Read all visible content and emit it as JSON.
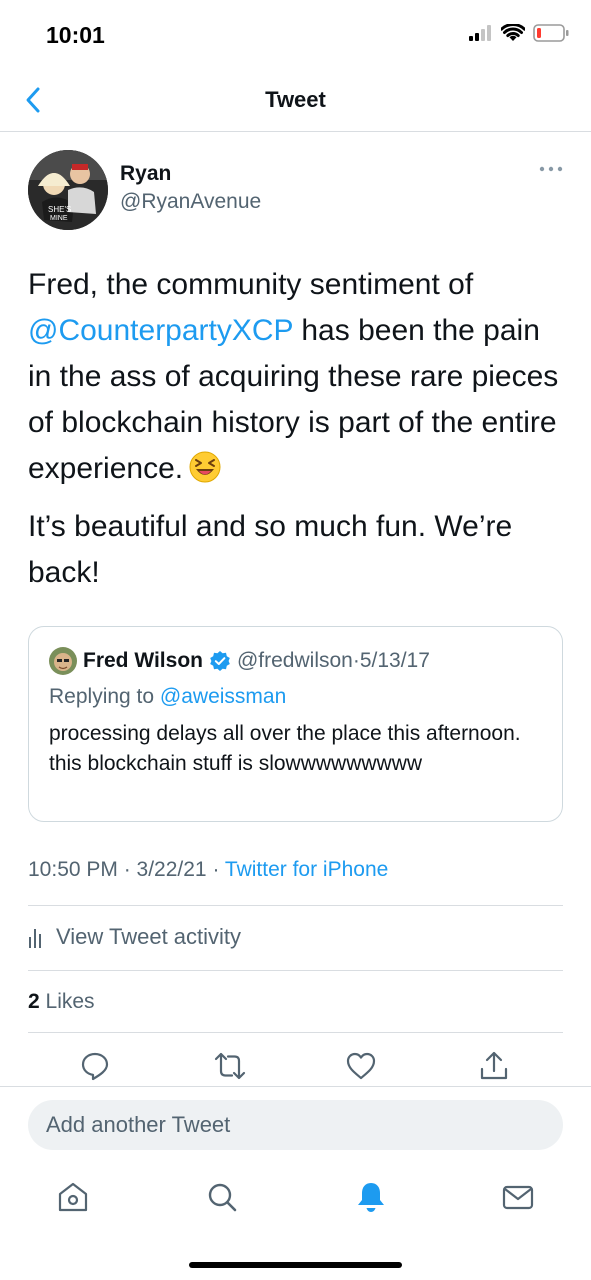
{
  "status_bar": {
    "time": "10:01"
  },
  "nav": {
    "title": "Tweet"
  },
  "tweet": {
    "author_name": "Ryan",
    "author_handle": "@RyanAvenue",
    "text_part1": "Fred, the community sentiment of ",
    "mention": "@CounterpartyXCP",
    "text_part2": " has been the pain in the ass of acquiring these rare pieces of blockchain history is part of the entire experience.",
    "paragraph2": "It’s beautiful and so much fun. We’re back!",
    "timestamp": "10:50 PM · 3/22/21 · ",
    "source": "Twitter for iPhone",
    "activity_label": "View Tweet activity",
    "likes_count": "2",
    "likes_label": " Likes"
  },
  "quoted_tweet": {
    "name": "Fred Wilson",
    "handle": "@fredwilson",
    "separator": " · ",
    "date": "5/13/17",
    "replying_prefix": "Replying to ",
    "replying_to": "@aweissman",
    "text": "processing delays all over the place this afternoon. this blockchain stuff is slowwwwwwwww"
  },
  "compose": {
    "placeholder": "Add another Tweet"
  },
  "colors": {
    "accent": "#1d9bf0",
    "secondary_text": "#536471",
    "divider": "#d9dde1"
  },
  "icons": [
    "back-icon",
    "more-icon",
    "verified-icon",
    "analytics-icon",
    "reply-icon",
    "retweet-icon",
    "like-icon",
    "share-icon",
    "home-icon",
    "search-icon",
    "notifications-icon",
    "messages-icon"
  ]
}
